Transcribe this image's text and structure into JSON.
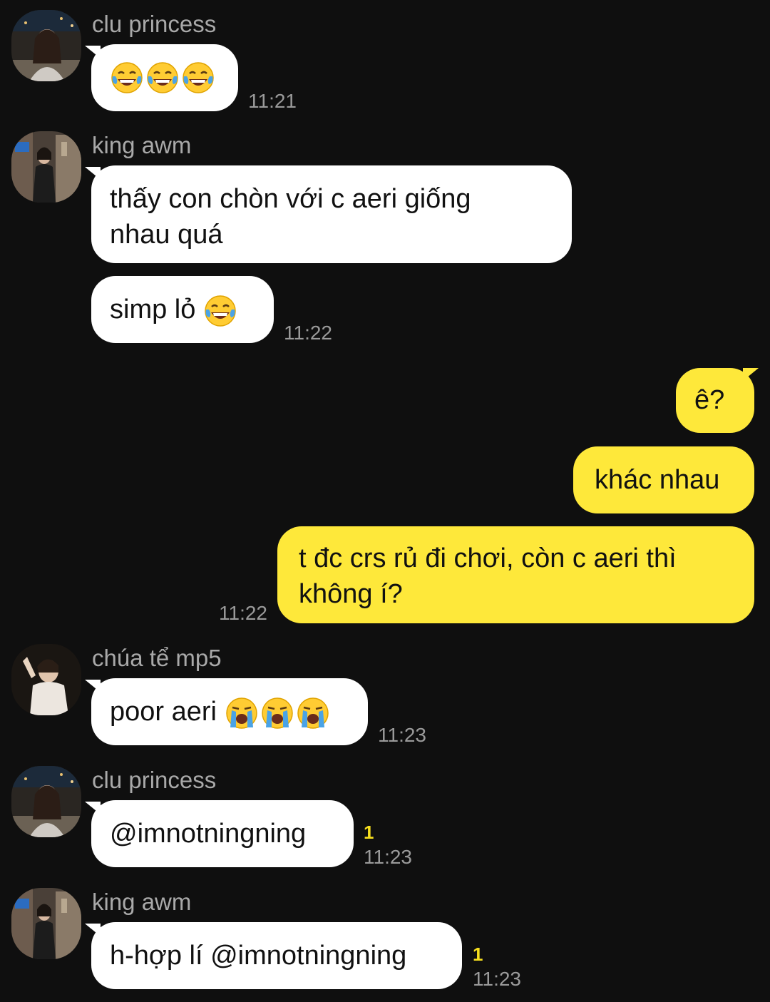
{
  "colors": {
    "background": "#0f0f0f",
    "incoming_bubble": "#ffffff",
    "outgoing_bubble": "#fee83a",
    "unread_badge": "#f7df1e",
    "sender_name": "#a9a9a9",
    "timestamp": "#9a9a9a"
  },
  "messages": [
    {
      "sender": "clu princess",
      "text": "",
      "emojis": [
        "face-with-tears-of-joy-icon",
        "face-with-tears-of-joy-icon",
        "face-with-tears-of-joy-icon"
      ],
      "time": "11:21"
    },
    {
      "sender": "king awm",
      "line1": "thấy con chòn với c aeri giống",
      "line2": "nhau quá"
    },
    {
      "text": "simp lỏ",
      "emojis": [
        "face-with-tears-of-joy-icon"
      ],
      "time": "11:22"
    },
    {
      "text": "ê?"
    },
    {
      "text": "khác nhau"
    },
    {
      "line1": "t đc crs rủ đi chơi, còn c aeri thì",
      "line2": "không í?",
      "time": "11:22"
    },
    {
      "sender": "chúa tể mp5",
      "text": "poor aeri",
      "emojis": [
        "loudly-crying-face-icon",
        "loudly-crying-face-icon",
        "loudly-crying-face-icon"
      ],
      "time": "11:23"
    },
    {
      "sender": "clu princess",
      "text": "@imnotningning",
      "unread": "1",
      "time": "11:23"
    },
    {
      "sender": "king awm",
      "text": "h-hợp lí @imnotningning",
      "unread": "1",
      "time": "11:23"
    }
  ]
}
